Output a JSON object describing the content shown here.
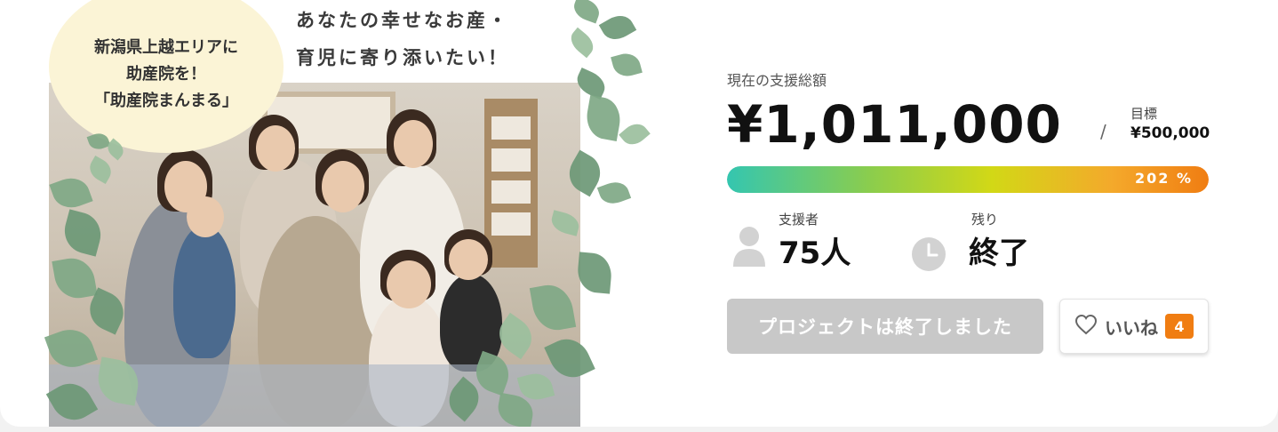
{
  "hero": {
    "bubble_lines": [
      "新潟県上越エリアに",
      "助産院を！",
      "「助産院まんまる」"
    ],
    "catch_lines": [
      "あなたの幸せなお産・",
      "育児に寄り添いたい！"
    ]
  },
  "funding": {
    "total_label": "現在の支援総額",
    "total_amount": "¥1,011,000",
    "separator": "/",
    "goal_label": "目標",
    "goal_amount": "¥500,000",
    "progress_percent_text": "202 %",
    "progress_fraction": 2.02
  },
  "stats": {
    "supporters_label": "支援者",
    "supporters_value": "75人",
    "remaining_label": "残り",
    "remaining_value": "終了"
  },
  "actions": {
    "ended_button_label": "プロジェクトは終了しました",
    "like_label": "いいね",
    "like_count": "4"
  },
  "colors": {
    "accent": "#f07d12",
    "disabled": "#c8c8c8",
    "progress_start": "#34c6b0",
    "progress_end": "#f07d12"
  },
  "icons": {
    "supporters": "person-icon",
    "remaining": "clock-icon",
    "like": "heart-icon"
  }
}
